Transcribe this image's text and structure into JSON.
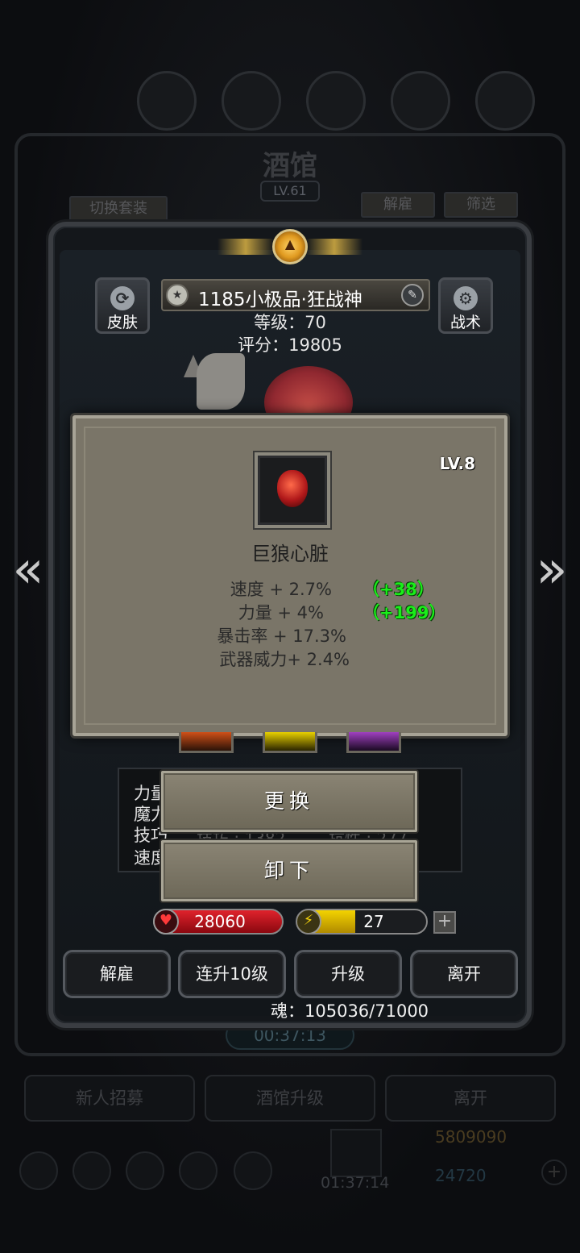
{
  "background": {
    "title": "酒馆",
    "level": "LV.61",
    "switch_outfit": "切换套装",
    "fire": "解雇",
    "filter": "筛选",
    "timer": "00:37:13",
    "bottom_buttons": [
      "新人招募",
      "酒馆升级",
      "离开"
    ],
    "chest_timer": "01:37:14",
    "gold": "5809090",
    "gems": "24720"
  },
  "hero": {
    "name": "1185小极品·狂战神",
    "level_text": "等级：70",
    "score_text": "评分：19805",
    "skin_label": "皮肤",
    "tactic_label": "战术"
  },
  "item": {
    "name": "巨狼心脏",
    "level": "LV.8",
    "stats": [
      {
        "text": "速度 + 2.7%",
        "bonus": "（+38）"
      },
      {
        "text": "力量 + 4%",
        "bonus": "（+199）"
      },
      {
        "text": "暴击率 + 17.3%",
        "bonus": ""
      },
      {
        "text": "武器威力+ 2.4%",
        "bonus": ""
      }
    ]
  },
  "attributes": {
    "labels": [
      "力量",
      "魔力",
      "技巧",
      "速度"
    ],
    "partial": [
      "技巧 : 1382",
      "抗性 : 277"
    ]
  },
  "actions": {
    "replace": "更换",
    "unequip": "卸下"
  },
  "bars": {
    "hp": "28060",
    "energy": "27",
    "energy_fill": 0.45
  },
  "bottom_actions": {
    "fire": "解雇",
    "level_up_10": "连升10级",
    "level_up": "升级",
    "leave": "离开"
  },
  "soul": "魂：105036/71000",
  "colors": {
    "panel": "#7a7568",
    "bonus_green": "#1aee1a",
    "hp_red": "#e0222c",
    "energy_yellow": "#f3d300"
  }
}
